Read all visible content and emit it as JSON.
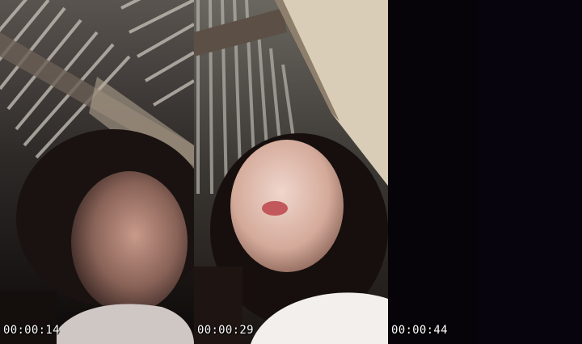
{
  "frames": [
    {
      "timestamp": "00:00:14"
    },
    {
      "timestamp": "00:00:29"
    },
    {
      "timestamp": "00:00:44"
    }
  ]
}
